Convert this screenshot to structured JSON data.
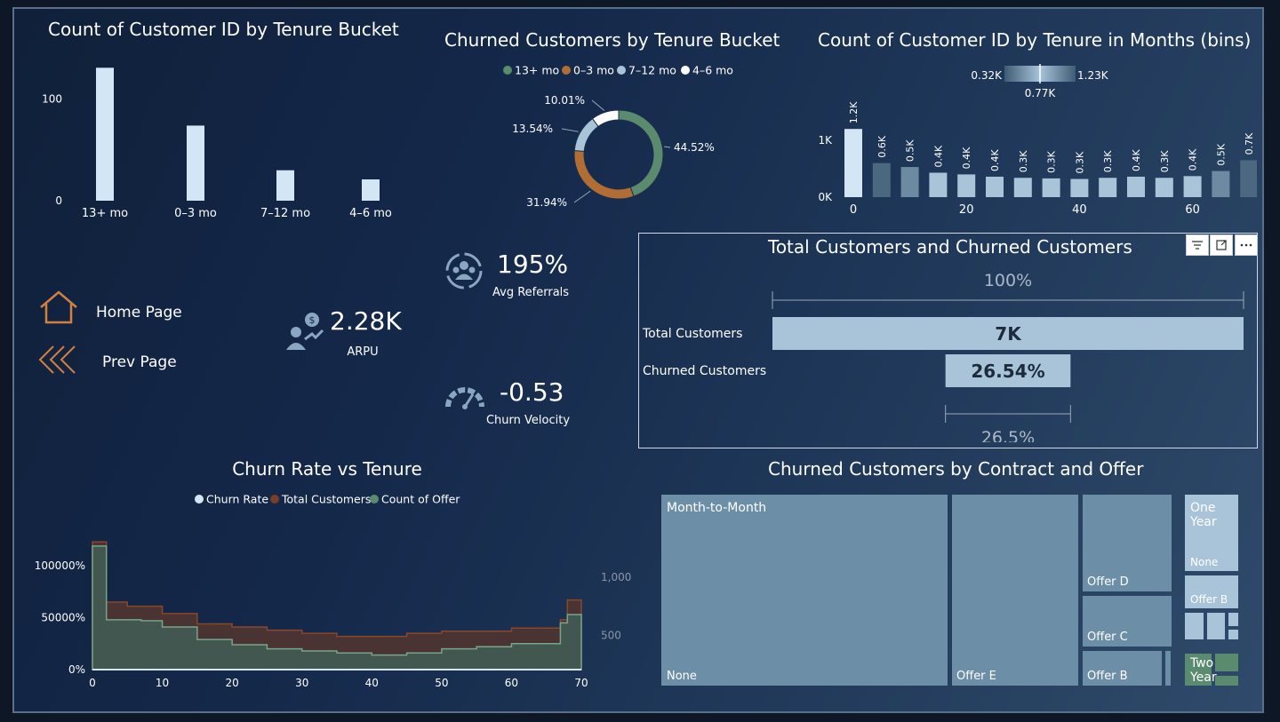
{
  "colors": {
    "bar_light": "#d2e6f5",
    "bar_mid": "#57768e",
    "donut_13": "#5b8b6e",
    "donut_0_3": "#b26d35",
    "donut_7_12": "#a9c4d9",
    "donut_4_6": "#ffffff",
    "accent_orange": "#d0803f",
    "treemap": "#6c8fa7",
    "treemap_light": "#a9c4d9",
    "treemap_green": "#5b8b6e"
  },
  "nav": {
    "home_label": "Home Page",
    "prev_label": "Prev Page"
  },
  "kpis": {
    "referrals_value": "195%",
    "referrals_label": "Avg Referrals",
    "arpu_value": "2.28K",
    "arpu_label": "ARPU",
    "velocity_value": "-0.53",
    "velocity_label": "Churn Velocity"
  },
  "chart_data": [
    {
      "id": "tenure_bucket_bar",
      "type": "bar",
      "title": "Count of Customer ID by Tenure Bucket",
      "categories": [
        "13+ mo",
        "0–3 mo",
        "7–12 mo",
        "4–6 mo"
      ],
      "values": [
        131,
        74,
        30,
        21
      ],
      "yticks": [
        "0",
        "100"
      ],
      "ylim": [
        0,
        140
      ]
    },
    {
      "id": "churn_donut",
      "type": "pie",
      "title": "Churned Customers by Tenure Bucket",
      "legend": [
        "13+ mo",
        "0–3 mo",
        "7–12 mo",
        "4–6 mo"
      ],
      "values": [
        44.52,
        31.94,
        13.54,
        10.01
      ],
      "labels": [
        "44.52%",
        "31.94%",
        "13.54%",
        "10.01%"
      ],
      "legend_position": "top"
    },
    {
      "id": "tenure_months_bins",
      "type": "bar",
      "title": "Count of Customer ID by Tenure in Months (bins)",
      "x": [
        0,
        5,
        10,
        15,
        20,
        25,
        30,
        35,
        40,
        45,
        50,
        55,
        60,
        65,
        70
      ],
      "values": [
        1200,
        600,
        530,
        430,
        400,
        360,
        340,
        330,
        320,
        340,
        360,
        340,
        370,
        460,
        650
      ],
      "data_labels": [
        "1.2K",
        "0.6K",
        "0.5K",
        "0.4K",
        "0.4K",
        "0.4K",
        "0.3K",
        "0.3K",
        "0.3K",
        "0.3K",
        "0.4K",
        "0.3K",
        "0.4K",
        "0.5K",
        "0.7K"
      ],
      "xticks": [
        "0",
        "20",
        "40",
        "60"
      ],
      "yticks": [
        "0K",
        "1K"
      ],
      "gradient_legend": {
        "min": "0.32K",
        "mid": "0.77K",
        "max": "1.23K"
      },
      "ylim": [
        0,
        1300
      ]
    },
    {
      "id": "funnel",
      "type": "bar",
      "title": "Total Customers and Churned Customers",
      "categories": [
        "Total Customers",
        "Churned Customers"
      ],
      "values": [
        100,
        26.54
      ],
      "value_labels": [
        "7K",
        "26.54%"
      ],
      "top_label": "100%",
      "bottom_label": "26.5%"
    },
    {
      "id": "churn_vs_tenure",
      "type": "area",
      "title": "Churn Rate vs Tenure",
      "legend": [
        "Churn Rate",
        "Total Customers",
        "Count of Offer"
      ],
      "x": [
        0,
        2,
        3,
        5,
        7,
        10,
        12,
        15,
        20,
        25,
        30,
        35,
        40,
        45,
        50,
        55,
        60,
        62,
        67,
        68,
        70
      ],
      "series": [
        {
          "name": "Total Customers",
          "values": [
            1230,
            650,
            650,
            610,
            610,
            540,
            540,
            440,
            410,
            380,
            350,
            320,
            320,
            350,
            370,
            370,
            400,
            400,
            480,
            670,
            670
          ]
        },
        {
          "name": "Count of Offer",
          "values": [
            1190,
            480,
            480,
            480,
            470,
            410,
            410,
            290,
            240,
            200,
            180,
            160,
            140,
            160,
            200,
            220,
            250,
            250,
            450,
            530,
            530
          ]
        },
        {
          "name": "Churn Rate",
          "values": [
            0,
            0,
            0,
            0,
            0,
            0,
            0,
            0,
            0,
            0,
            0,
            0,
            0,
            0,
            0,
            0,
            0,
            0,
            0,
            0,
            0
          ]
        }
      ],
      "yticks_left": [
        "0%",
        "50000%",
        "100000%"
      ],
      "yticks_right": [
        "500",
        "1,000"
      ],
      "xticks": [
        "0",
        "10",
        "20",
        "30",
        "40",
        "50",
        "60",
        "70"
      ],
      "xlim": [
        0,
        70
      ],
      "ylim": [
        0,
        1300
      ]
    },
    {
      "id": "treemap",
      "type": "heatmap",
      "title": "Churned Customers by Contract and Offer",
      "groups": [
        {
          "name": "Month-to-Month",
          "cells": [
            "None",
            "Offer E",
            "Offer D",
            "Offer C",
            "Offer B"
          ]
        },
        {
          "name": "One Year",
          "cells": [
            "None",
            "Offer B"
          ]
        },
        {
          "name": "Two Year",
          "cells": []
        }
      ]
    }
  ]
}
